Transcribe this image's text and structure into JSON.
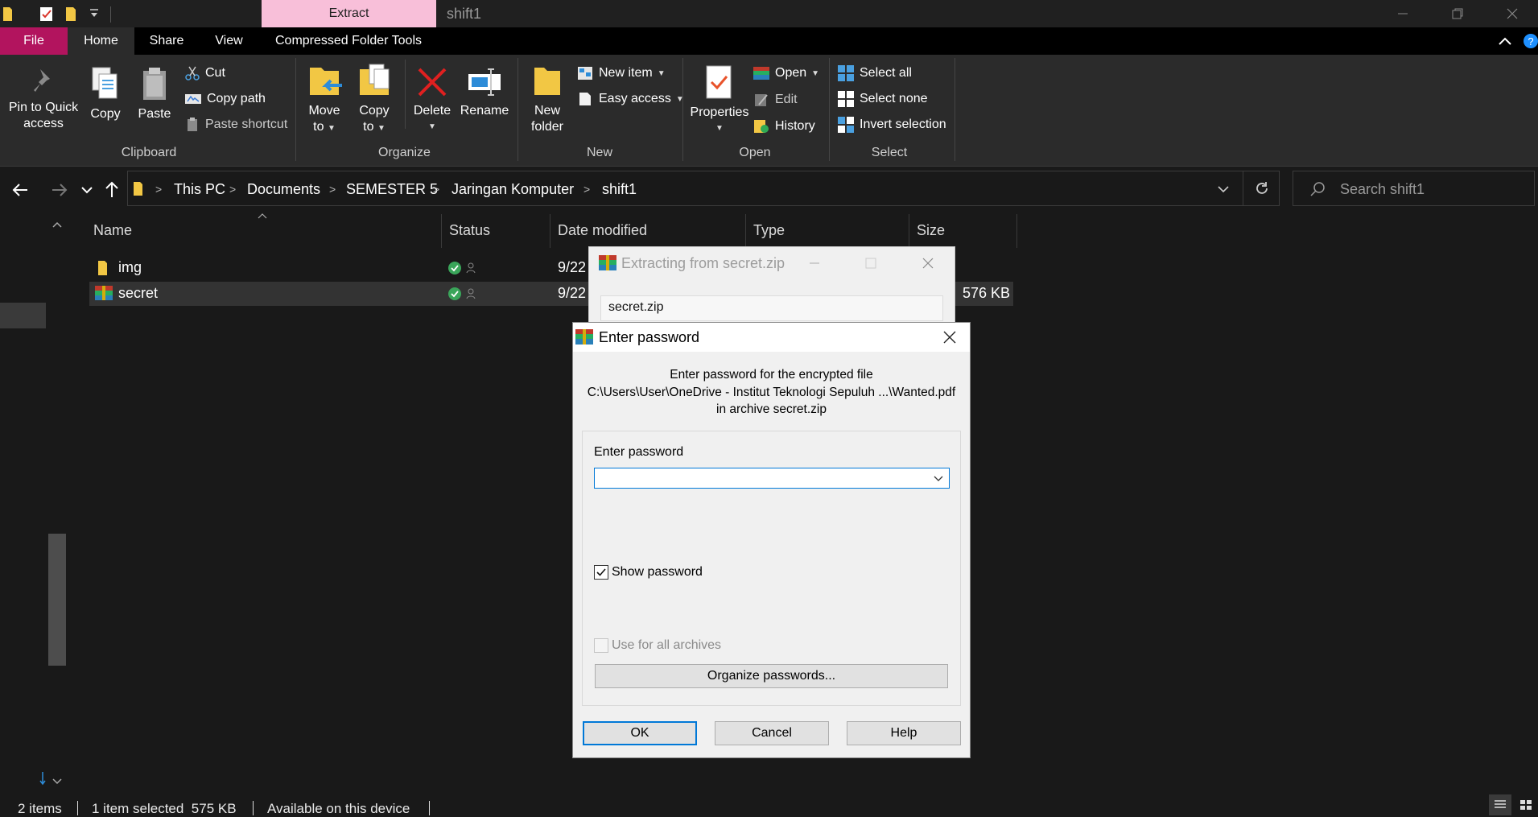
{
  "window": {
    "context_tab": "Extract",
    "title": "shift1"
  },
  "ribbon_tabs": [
    "File",
    "Home",
    "Share",
    "View",
    "Compressed Folder Tools"
  ],
  "ribbon": {
    "clipboard": {
      "pin": [
        "Pin to Quick",
        "access"
      ],
      "copy": "Copy",
      "paste": "Paste",
      "cut": "Cut",
      "copy_path": "Copy path",
      "paste_shortcut": "Paste shortcut",
      "group": "Clipboard"
    },
    "organize": {
      "move_to": [
        "Move",
        "to"
      ],
      "copy_to": [
        "Copy",
        "to"
      ],
      "delete": "Delete",
      "rename": "Rename",
      "group": "Organize"
    },
    "new": {
      "new_folder": [
        "New",
        "folder"
      ],
      "new_item": "New item",
      "easy_access": "Easy access",
      "group": "New"
    },
    "open": {
      "properties": "Properties",
      "open": "Open",
      "edit": "Edit",
      "history": "History",
      "group": "Open"
    },
    "select": {
      "select_all": "Select all",
      "select_none": "Select none",
      "invert": "Invert selection",
      "group": "Select"
    }
  },
  "breadcrumb": [
    "This PC",
    "Documents",
    "SEMESTER 5",
    "Jaringan Komputer",
    "shift1"
  ],
  "search": {
    "placeholder": "Search shift1"
  },
  "columns": [
    "Name",
    "Status",
    "Date modified",
    "Type",
    "Size"
  ],
  "files": [
    {
      "name": "img",
      "date": "9/22",
      "size": ""
    },
    {
      "name": "secret",
      "date": "9/22",
      "size": "576 KB"
    }
  ],
  "statusbar": {
    "items": "2 items",
    "selected": "1 item selected  575 KB",
    "availability": "Available on this device"
  },
  "progress_dialog": {
    "title": "Extracting from secret.zip",
    "file": "secret.zip"
  },
  "password_dialog": {
    "title": "Enter password",
    "info_line1": "Enter password for the encrypted file",
    "info_line2": "C:\\Users\\User\\OneDrive - Institut Teknologi Sepuluh ...\\Wanted.pdf",
    "info_line3": "in archive secret.zip",
    "field_label": "Enter password",
    "field_value": "",
    "show_password": "Show password",
    "show_password_checked": true,
    "use_for_all": "Use for all archives",
    "use_for_all_checked": false,
    "organize": "Organize passwords...",
    "ok": "OK",
    "cancel": "Cancel",
    "help": "Help"
  },
  "colors": {
    "file_tab": "#b2145e",
    "extract_tab": "#f8bfd9",
    "accent": "#0078d7"
  }
}
